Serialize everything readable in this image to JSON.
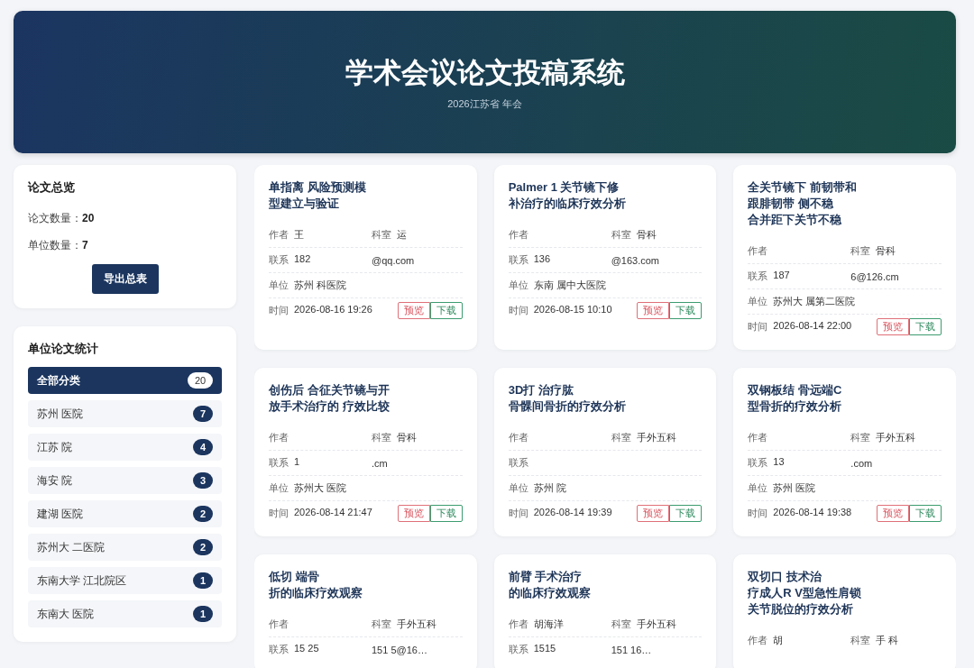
{
  "header": {
    "title": "学术会议论文投稿系统",
    "subtitle": "2026江苏省 年会"
  },
  "overview": {
    "title": "论文总览",
    "stats": [
      {
        "label": "论文数量：",
        "value": "20"
      },
      {
        "label": "单位数量：",
        "value": "7"
      }
    ],
    "button": "导出总表"
  },
  "unit_stats": {
    "title": "单位论文统计",
    "items": [
      {
        "name": "全部分类",
        "count": "20",
        "selected": true
      },
      {
        "name": "苏州 医院",
        "count": "7",
        "selected": false
      },
      {
        "name": "江苏 院",
        "count": "4",
        "selected": false
      },
      {
        "name": "海安 院",
        "count": "3",
        "selected": false
      },
      {
        "name": "建湖 医院",
        "count": "2",
        "selected": false
      },
      {
        "name": "苏州大 二医院",
        "count": "2",
        "selected": false
      },
      {
        "name": "东南大学 江北院区",
        "count": "1",
        "selected": false
      },
      {
        "name": "东南大 医院",
        "count": "1",
        "selected": false
      }
    ]
  },
  "papers": [
    {
      "title_lines": [
        "单指离 风险预测模",
        "型建立与验证"
      ],
      "author_label": "作者",
      "author": "王",
      "dept_label": "科室",
      "dept": "运",
      "contact_label": "联系",
      "phone": "182",
      "email": "@qq.com",
      "unit_label": "单位",
      "unit": "苏州 科医院",
      "time_label": "时间",
      "time": "2026-08-16 19:26",
      "actions": [
        "预览",
        "下载"
      ]
    },
    {
      "title_lines": [
        "Palmer 1 关节镜下修",
        "补治疗的临床疗效分析"
      ],
      "author_label": "作者",
      "dept_label": "科室",
      "dept": "骨科",
      "contact_label": "联系",
      "phone": "136",
      "email": "@163.com",
      "unit_label": "单位",
      "unit": "东南 属中大医院",
      "time_label": "时间",
      "time": "2026-08-15 10:10",
      "actions": [
        "预览",
        "下载"
      ]
    },
    {
      "title_lines": [
        "全关节镜下 前韧带和",
        "跟腓韧带 侧不稳",
        "合并距下关节不稳"
      ],
      "author_label": "作者",
      "dept_label": "科室",
      "dept": "骨科",
      "contact_label": "联系",
      "phone": "187",
      "email": "6@126.cm",
      "unit_label": "单位",
      "unit": "苏州大 属第二医院",
      "time_label": "时间",
      "time": "2026-08-14 22:00",
      "actions": [
        "预览",
        "下载"
      ]
    },
    {
      "title_lines": [
        "创伤后 合征关节镜与开",
        "放手术治疗的 疗效比较"
      ],
      "author_label": "作者",
      "dept_label": "科室",
      "dept": "骨科",
      "contact_label": "联系",
      "phone": "1",
      "email": ".cm",
      "unit_label": "单位",
      "unit": "苏州大 医院",
      "time_label": "时间",
      "time": "2026-08-14 21:47",
      "actions": [
        "预览",
        "下载"
      ]
    },
    {
      "title_lines": [
        "3D打 治疗肱",
        "骨髁间骨折的疗效分析"
      ],
      "author_label": "作者",
      "dept_label": "科室",
      "dept": "手外五科",
      "contact_label": "联系",
      "unit_label": "单位",
      "unit": "苏州 院",
      "time_label": "时间",
      "time": "2026-08-14 19:39",
      "actions": [
        "预览",
        "下载"
      ]
    },
    {
      "title_lines": [
        "双钢板结 骨远端C",
        "型骨折的疗效分析"
      ],
      "author_label": "作者",
      "dept_label": "科室",
      "dept": "手外五科",
      "contact_label": "联系",
      "phone": "13",
      "email": ".com",
      "unit_label": "单位",
      "unit": "苏州 医院",
      "time_label": "时间",
      "time": "2026-08-14 19:38",
      "actions": [
        "预览",
        "下载"
      ]
    },
    {
      "title_lines": [
        "低切 端骨",
        "折的临床疗效观察"
      ],
      "author_label": "作者",
      "dept_label": "科室",
      "dept": "手外五科",
      "contact_label": "联系",
      "phone": "15 25",
      "email": "151 5@16…"
    },
    {
      "title_lines": [
        "前臂 手术治疗",
        "的临床疗效观察"
      ],
      "author_label": "作者",
      "author": "胡海洋",
      "dept_label": "科室",
      "dept": "手外五科",
      "contact_label": "联系",
      "phone": "1515",
      "email": "151 16…"
    },
    {
      "title_lines": [
        "双切口 技术治",
        "疗成人R V型急性肩锁",
        "关节脱位的疗效分析"
      ],
      "author_label": "作者",
      "author": "胡",
      "dept_label": "科室",
      "dept": "手 科"
    }
  ]
}
